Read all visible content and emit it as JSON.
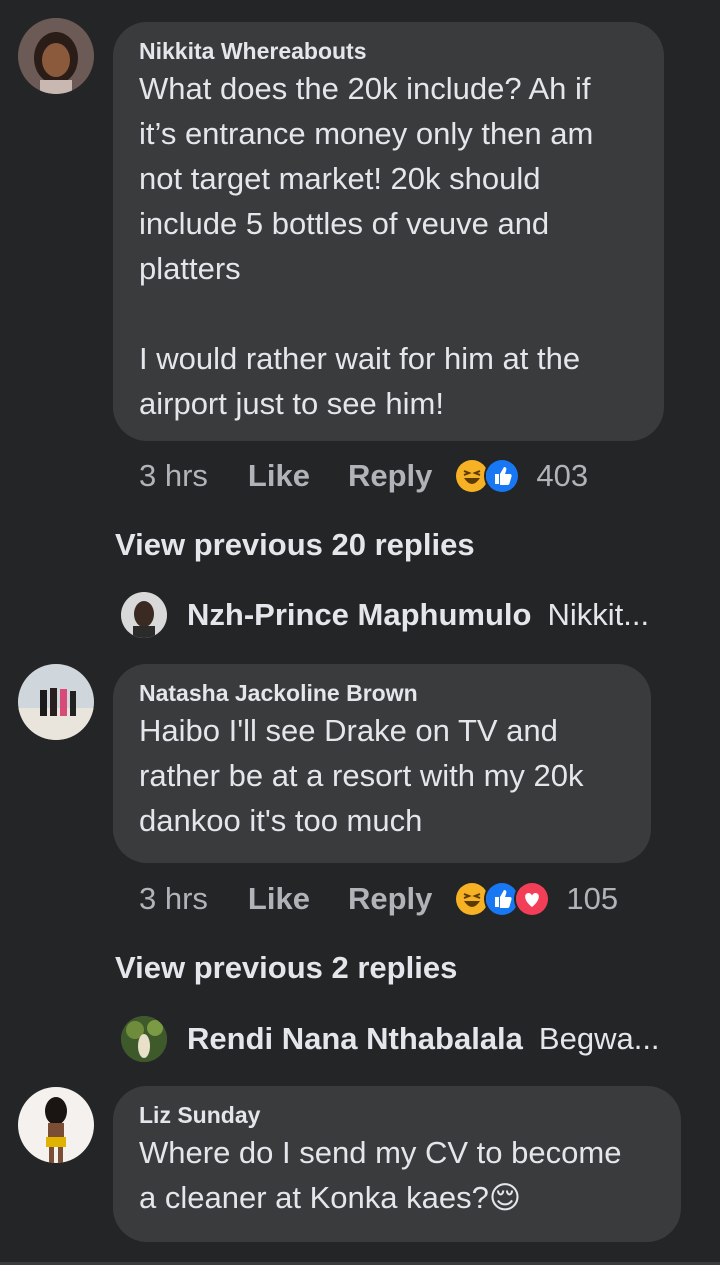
{
  "comments": [
    {
      "author": "Nikkita Whereabouts",
      "text": "What does the 20k include? Ah if\nit’s entrance money only then am\nnot target market! 20k should\ninclude 5 bottles of veuve and\nplatters\n\nI would rather wait for him at the\nairport just to see him!",
      "time": "3 hrs",
      "like_label": "Like",
      "reply_label": "Reply",
      "reaction_count": "403",
      "reactions": [
        "haha-icon",
        "like-icon"
      ]
    },
    {
      "author": "Natasha Jackoline Brown",
      "text": "Haibo I'll see Drake on TV and\nrather be at a resort with my 20k\ndankoo it's too much",
      "time": "3 hrs",
      "like_label": "Like",
      "reply_label": "Reply",
      "reaction_count": "105",
      "reactions": [
        "haha-icon",
        "like-icon",
        "love-icon"
      ]
    },
    {
      "author": "Liz Sunday",
      "text": "Where do I send my CV to become\na cleaner at Konka kaes?😌"
    }
  ],
  "threads": [
    {
      "view_previous": "View previous 20 replies",
      "preview_author": "Nzh-Prince Maphumulo",
      "preview_snippet": "Nikkit..."
    },
    {
      "view_previous": "View previous 2 replies",
      "preview_author": "Rendi Nana Nthabalala",
      "preview_snippet": "Begwa..."
    }
  ],
  "colors": {
    "background": "#242526",
    "bubble": "#3a3b3c",
    "primary_text": "#e4e6eb",
    "secondary_text": "#b0b3b8",
    "like_blue": "#1877f2",
    "love_red": "#f33e58",
    "haha_yellow": "#f7b125"
  }
}
